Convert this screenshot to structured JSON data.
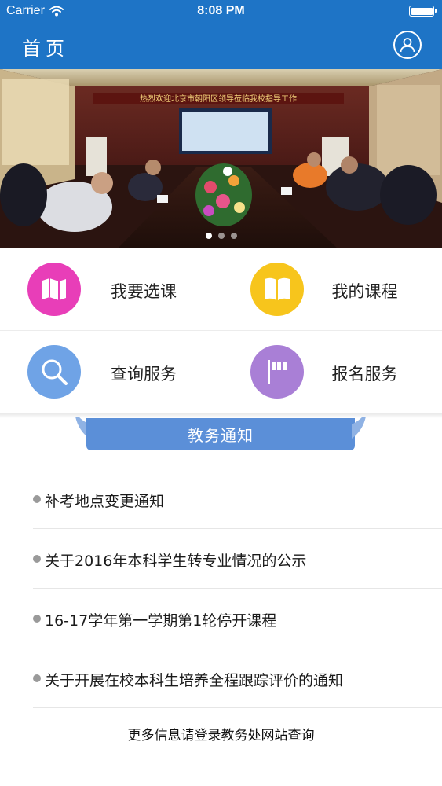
{
  "status": {
    "carrier": "Carrier",
    "time": "8:08 PM"
  },
  "nav": {
    "title": "首页",
    "user_icon": "user-icon"
  },
  "banner": {
    "sign_text": "热烈欢迎北京市朝阳区领导莅临我校指导工作",
    "slides": 3,
    "active_slide": 0
  },
  "menu": [
    {
      "label": "我要选课",
      "icon": "map-icon",
      "color": "#e83eb8"
    },
    {
      "label": "我的课程",
      "icon": "book-icon",
      "color": "#f7c51c"
    },
    {
      "label": "查询服务",
      "icon": "search-icon",
      "color": "#6fa3e6"
    },
    {
      "label": "报名服务",
      "icon": "flag-icon",
      "color": "#a97fd6"
    }
  ],
  "notices": {
    "header": "教务通知",
    "items": [
      "补考地点变更通知",
      "关于2016年本科学生转专业情况的公示",
      "16-17学年第一学期第1轮停开课程",
      "关于开展在校本科生培养全程跟踪评价的通知"
    ],
    "footer": "更多信息请登录教务处网站查询"
  },
  "colors": {
    "nav_bg": "#1e74c6",
    "ribbon": "#5b8fd8"
  }
}
